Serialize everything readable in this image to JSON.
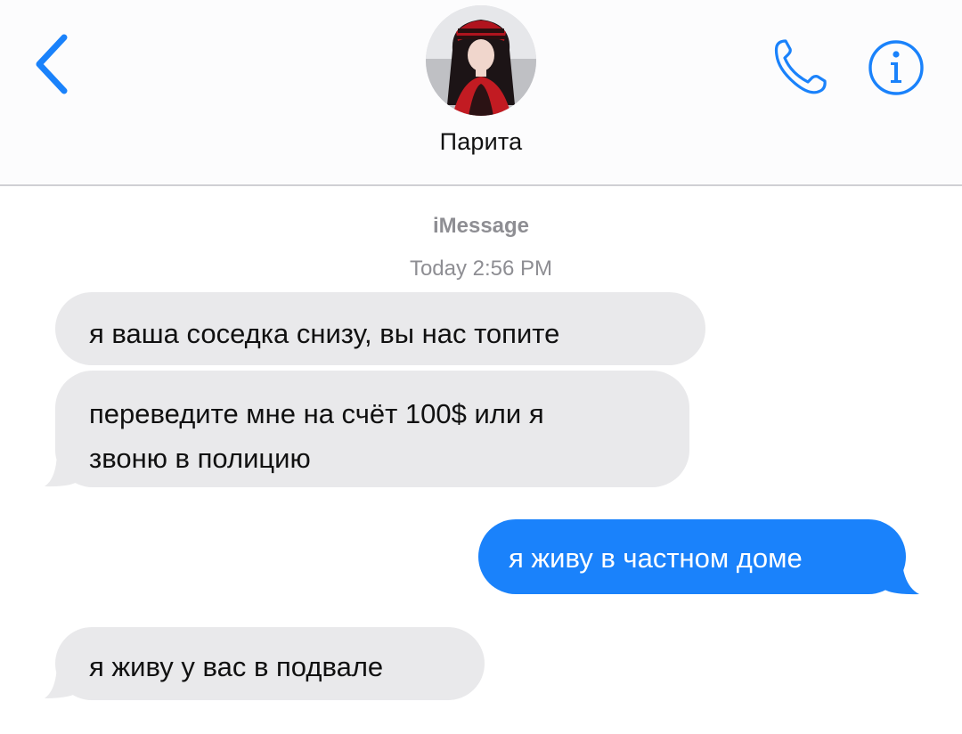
{
  "header": {
    "contact_name": "Парита",
    "back_icon": "chevron-left-icon",
    "phone_icon": "phone-icon",
    "info_icon": "info-icon",
    "accent_color": "#1a82fb"
  },
  "conversation": {
    "service": "iMessage",
    "day": "Today",
    "time": "2:56 PM",
    "messages": [
      {
        "direction": "received",
        "text": "я ваша соседка снизу, вы нас топите"
      },
      {
        "direction": "received",
        "lines": [
          "переведите мне на счёт 100$ или я",
          "звоню в полицию"
        ]
      },
      {
        "direction": "sent",
        "text": "я живу в частном доме"
      },
      {
        "direction": "received",
        "text": "я живу у вас в подвале"
      }
    ]
  },
  "colors": {
    "sent_bubble": "#1a82fb",
    "received_bubble": "#e9e9eb",
    "meta_text": "#8e8e93"
  }
}
